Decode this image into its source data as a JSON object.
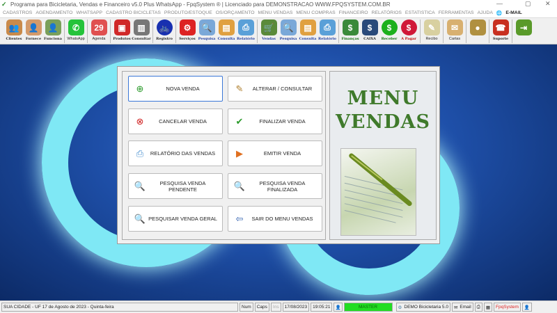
{
  "window": {
    "title": "Programa para Bicicletaria, Vendas e Financeiro v5.0 Plus WhatsApp - FpqSystem ® | Licenciado para  DEMONSTRACAO WWW.FPQSYSTEM.COM.BR",
    "minimize": "—",
    "maximize": "▢",
    "close": "✕"
  },
  "menu": [
    "CADASTROS",
    "AGENDAMENTO",
    "WHATSAPP",
    "CADASTRO BICICLETAS",
    "PRODUTO/ESTOQUE",
    "OS/ORÇAMENTO",
    "MENU VENDAS",
    "MENU COMPRAS",
    "FINANCEIRO",
    "RELATÓRIOS",
    "ESTATISTICA",
    "FERRAMENTAS",
    "AJUDA",
    "E-MAIL"
  ],
  "toolbar": [
    {
      "label": "Clientes",
      "icon": "users-icon",
      "color": "#c98a4a",
      "glyph": "👥"
    },
    {
      "label": "Fornece",
      "icon": "supplier-icon",
      "color": "#d49a6a",
      "glyph": "👤"
    },
    {
      "label": "Funciona",
      "icon": "employee-icon",
      "color": "#7aa05a",
      "glyph": "👤"
    },
    {
      "label": "WhatsApp",
      "icon": "whatsapp-icon",
      "color": "#25c33a",
      "glyph": "✆"
    },
    {
      "label": "Agenda",
      "icon": "calendar-icon",
      "color": "#e05050",
      "glyph": "29"
    },
    {
      "label": "Produtos",
      "icon": "products-icon",
      "color": "#d02828",
      "glyph": "▣"
    },
    {
      "label": "Consultar",
      "icon": "barcode-icon",
      "color": "#777",
      "glyph": "▥"
    },
    {
      "label": "Registro",
      "icon": "bicycle-icon",
      "color": "#1830b0",
      "glyph": "🚲"
    },
    {
      "label": "Serviços",
      "icon": "service-icon",
      "color": "#d22",
      "glyph": "⚙"
    },
    {
      "label": "Pesquisa",
      "icon": "search-icon",
      "color": "#7aa8d8",
      "glyph": "🔍"
    },
    {
      "label": "Consulta",
      "icon": "folder-icon",
      "color": "#e0a040",
      "glyph": "▤"
    },
    {
      "label": "Relatório",
      "icon": "printer-icon",
      "color": "#5aa0d8",
      "glyph": "⎙"
    },
    {
      "label": "Vendas",
      "icon": "cart-icon",
      "color": "#5a8a3a",
      "glyph": "🛒"
    },
    {
      "label": "Pesquisa",
      "icon": "search-icon",
      "color": "#7aa8d8",
      "glyph": "🔍"
    },
    {
      "label": "Consulta",
      "icon": "folder-icon",
      "color": "#e0a040",
      "glyph": "▤"
    },
    {
      "label": "Relatório",
      "icon": "printer-icon",
      "color": "#5aa0d8",
      "glyph": "⎙"
    },
    {
      "label": "Finanças",
      "icon": "finance-icon",
      "color": "#3a8a3a",
      "glyph": "$"
    },
    {
      "label": "CAIXA",
      "icon": "cashbook-icon",
      "color": "#2a4a7a",
      "glyph": "$"
    },
    {
      "label": "Receber",
      "icon": "receive-money-icon",
      "color": "#1cb01c",
      "glyph": "$"
    },
    {
      "label": "A Pagar",
      "icon": "pay-money-icon",
      "color": "#d01838",
      "glyph": "$"
    },
    {
      "label": "Recibo",
      "icon": "receipt-icon",
      "color": "#d8d0a0",
      "glyph": "✎"
    },
    {
      "label": "Cartas",
      "icon": "letter-icon",
      "color": "#d8b070",
      "glyph": "✉"
    },
    {
      "label": "",
      "icon": "coins-icon",
      "color": "#b09040",
      "glyph": "●"
    },
    {
      "label": "Suporte",
      "icon": "support-icon",
      "color": "#c83020",
      "glyph": "☎"
    },
    {
      "label": "",
      "icon": "exit-door-icon",
      "color": "#5a9a2a",
      "glyph": "⇥"
    }
  ],
  "panel": {
    "buttons": [
      {
        "label": "NOVA VENDA",
        "icon": "new-document-icon",
        "glyph": "⊕",
        "color": "#2a9a2a"
      },
      {
        "label": "ALTERAR / CONSULTAR",
        "icon": "edit-pencil-icon",
        "glyph": "✎",
        "color": "#b08030"
      },
      {
        "label": "CANCELAR VENDA",
        "icon": "cancel-document-icon",
        "glyph": "⊗",
        "color": "#d02020"
      },
      {
        "label": "FINALIZAR VENDA",
        "icon": "check-document-icon",
        "glyph": "✔",
        "color": "#2a9a2a"
      },
      {
        "label": "RELATÓRIO DAS VENDAS",
        "icon": "printer-icon",
        "glyph": "⎙",
        "color": "#4a90d0"
      },
      {
        "label": "EMITIR VENDA",
        "icon": "emit-icon",
        "glyph": "▶",
        "color": "#e07020"
      },
      {
        "label": "PESQUISA VENDA PENDENTE",
        "icon": "search-pending-icon",
        "glyph": "🔍",
        "color": "#806040"
      },
      {
        "label": "PESQUISA VENDA FINALIZADA",
        "icon": "search-finished-icon",
        "glyph": "🔍",
        "color": "#806040"
      },
      {
        "label": "PESQUISAR VENDA GERAL",
        "icon": "search-general-icon",
        "glyph": "🔍",
        "color": "#806040"
      },
      {
        "label": "SAIR DO MENU VENDAS",
        "icon": "exit-icon",
        "glyph": "⇦",
        "color": "#3060b0"
      }
    ],
    "title_line1": "MENU",
    "title_line2": "VENDAS"
  },
  "status": {
    "location": "SUA CIDADE - UF 17 de Agosto de 2023 - Quinta-feira",
    "num": "Num",
    "caps": "Caps",
    "ins": "Ins",
    "date": "17/08/2023",
    "time": "19:05:21",
    "user": "MASTER",
    "version": "DEMO Bicicletaria 5.0",
    "email": "Email",
    "brand": "FpqSystem",
    "user_color": "#22dd22",
    "brand_color": "#dd2222"
  }
}
